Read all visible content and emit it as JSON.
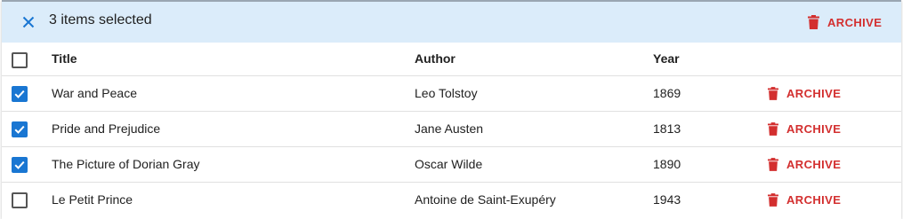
{
  "bulk_bar": {
    "count_label": "3 items selected",
    "archive_label": "ARCHIVE",
    "bg_color": "#dbecfa"
  },
  "table": {
    "columns": [
      "Title",
      "Author",
      "Year"
    ],
    "rows": [
      {
        "title": "War and Peace",
        "author": "Leo Tolstoy",
        "year": "1869",
        "selected": true,
        "action": "ARCHIVE"
      },
      {
        "title": "Pride and Prejudice",
        "author": "Jane Austen",
        "year": "1813",
        "selected": true,
        "action": "ARCHIVE"
      },
      {
        "title": "The Picture of Dorian Gray",
        "author": "Oscar Wilde",
        "year": "1890",
        "selected": true,
        "action": "ARCHIVE"
      },
      {
        "title": "Le Petit Prince",
        "author": "Antoine de Saint-Exupéry",
        "year": "1943",
        "selected": false,
        "action": "ARCHIVE"
      }
    ]
  },
  "colors": {
    "accent": "#1976d2",
    "danger": "#d32f2f"
  },
  "icons": {
    "close": "close-icon",
    "archive": "trash-icon",
    "checkbox_checked": "check-icon"
  }
}
